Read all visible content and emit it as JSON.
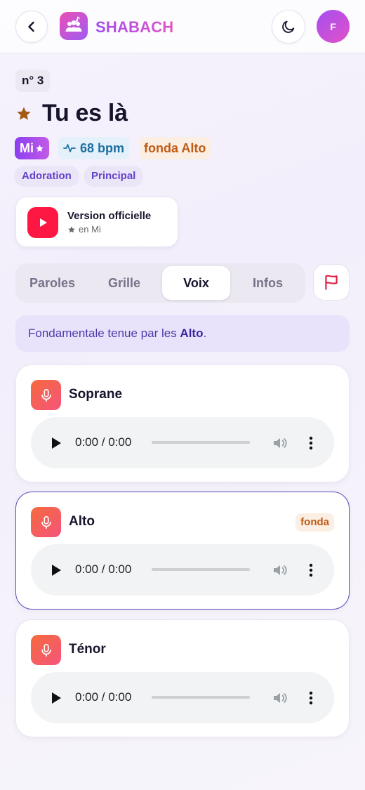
{
  "header": {
    "brand": "SHABACH",
    "avatar_letter": "F",
    "back_icon": "chevron-left-icon",
    "theme_icon": "moon-icon",
    "logo_icon": "group-music-icon"
  },
  "song": {
    "number": "n° 3",
    "title": "Tu es là",
    "key": "Mi",
    "bpm": "68 bpm",
    "fonda": "fonda Alto",
    "tags": [
      "Adoration",
      "Principal"
    ]
  },
  "version": {
    "title": "Version officielle",
    "subtitle": "en Mi"
  },
  "tabs": [
    "Paroles",
    "Grille",
    "Voix",
    "Infos"
  ],
  "active_tab": "Voix",
  "note": {
    "prefix": "Fondamentale tenue par les ",
    "voice": "Alto",
    "suffix": "."
  },
  "voices": [
    {
      "name": "Soprane",
      "time": "0:00 / 0:00",
      "badge": ""
    },
    {
      "name": "Alto",
      "time": "0:00 / 0:00",
      "badge": "fonda"
    },
    {
      "name": "Ténor",
      "time": "0:00 / 0:00",
      "badge": ""
    }
  ],
  "colors": {
    "accent_purple": "#8a3ff0",
    "accent_pink": "#e255c4",
    "fonda_orange": "#bf5b16",
    "youtube_red": "#ff1744",
    "mic_orange": "#f56a3e"
  }
}
